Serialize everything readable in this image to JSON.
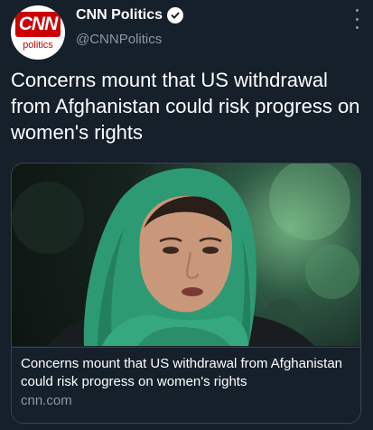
{
  "tweet": {
    "author": {
      "display_name": "CNN Politics",
      "handle": "@CNNPolitics",
      "avatar_logo_text": "CNN",
      "avatar_sub_text": "politics",
      "verified": true
    },
    "text": "Concerns mount that US withdrawal from Afghanistan could risk progress on women's rights",
    "link_card": {
      "image_alt": "woman-wearing-green-headscarf-photo",
      "title": "Concerns mount that US withdrawal from Afghanistan could risk progress on women's rights",
      "domain": "cnn.com"
    }
  },
  "icons": {
    "verified": "verified-badge-icon",
    "more": "more-options-icon"
  },
  "colors": {
    "background": "#15202b",
    "primary_text": "#ffffff",
    "secondary_text": "#8b98a5",
    "border": "#38444d",
    "cnn_red": "#cc0000",
    "headscarf_green": "#3aa37a"
  }
}
